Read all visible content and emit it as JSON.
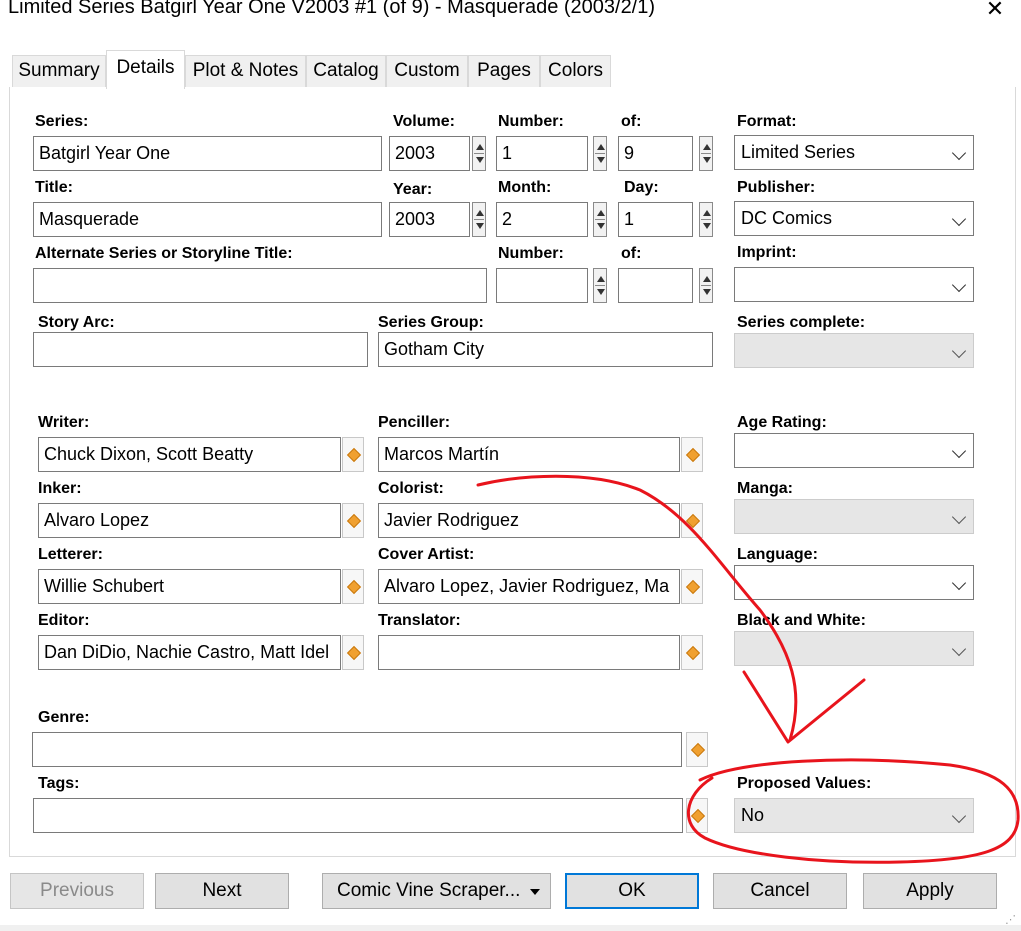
{
  "window": {
    "title": "Limited Series Batgirl Year One V2003 #1 (of 9) - Masquerade (2003/2/1)",
    "close_glyph": "✕"
  },
  "tabs": [
    {
      "label": "Summary",
      "active": false
    },
    {
      "label": "Details",
      "active": true
    },
    {
      "label": "Plot & Notes",
      "active": false
    },
    {
      "label": "Catalog",
      "active": false
    },
    {
      "label": "Custom",
      "active": false
    },
    {
      "label": "Pages",
      "active": false
    },
    {
      "label": "Colors",
      "active": false
    }
  ],
  "fields": {
    "series": {
      "label": "Series:",
      "value": "Batgirl Year One"
    },
    "volume": {
      "label": "Volume:",
      "value": "2003"
    },
    "number": {
      "label": "Number:",
      "value": "1"
    },
    "of": {
      "label": "of:",
      "value": "9"
    },
    "format": {
      "label": "Format:",
      "value": "Limited Series"
    },
    "title": {
      "label": "Title:",
      "value": "Masquerade"
    },
    "year": {
      "label": "Year:",
      "value": "2003"
    },
    "month": {
      "label": "Month:",
      "value": "2"
    },
    "day": {
      "label": "Day:",
      "value": "1"
    },
    "publisher": {
      "label": "Publisher:",
      "value": "DC Comics"
    },
    "alt_series": {
      "label": "Alternate Series or Storyline Title:",
      "value": ""
    },
    "alt_number": {
      "label": "Number:",
      "value": ""
    },
    "alt_of": {
      "label": "of:",
      "value": ""
    },
    "imprint": {
      "label": "Imprint:",
      "value": ""
    },
    "story_arc": {
      "label": "Story Arc:",
      "value": ""
    },
    "series_group": {
      "label": "Series Group:",
      "value": "Gotham City"
    },
    "series_complete": {
      "label": "Series complete:",
      "value": ""
    },
    "writer": {
      "label": "Writer:",
      "value": "Chuck Dixon, Scott Beatty"
    },
    "penciller": {
      "label": "Penciller:",
      "value": "Marcos Martín"
    },
    "age_rating": {
      "label": "Age Rating:",
      "value": ""
    },
    "inker": {
      "label": "Inker:",
      "value": "Alvaro Lopez"
    },
    "colorist": {
      "label": "Colorist:",
      "value": "Javier Rodriguez"
    },
    "manga": {
      "label": "Manga:",
      "value": ""
    },
    "letterer": {
      "label": "Letterer:",
      "value": "Willie Schubert"
    },
    "cover_artist": {
      "label": "Cover Artist:",
      "value": "Alvaro Lopez, Javier Rodriguez, Ma"
    },
    "language": {
      "label": "Language:",
      "value": ""
    },
    "editor": {
      "label": "Editor:",
      "value": "Dan DiDio, Nachie Castro, Matt Idel"
    },
    "translator": {
      "label": "Translator:",
      "value": ""
    },
    "black_and_white": {
      "label": "Black and White:",
      "value": ""
    },
    "genre": {
      "label": "Genre:",
      "value": ""
    },
    "tags": {
      "label": "Tags:",
      "value": ""
    },
    "proposed_values": {
      "label": "Proposed Values:",
      "value": "No"
    }
  },
  "buttons": {
    "previous": "Previous",
    "next": "Next",
    "scraper": "Comic Vine Scraper...",
    "ok": "OK",
    "cancel": "Cancel",
    "apply": "Apply"
  },
  "annotation": {
    "color": "#e8141c",
    "kind": "hand-drawn arrow and circle highlighting Proposed Values"
  },
  "colors": {
    "accent": "#0078d7",
    "picker": "#f0a030"
  }
}
